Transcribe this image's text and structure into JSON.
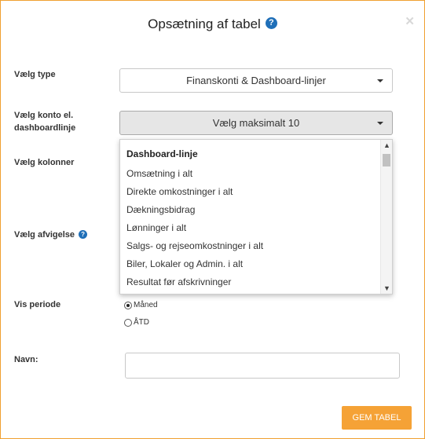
{
  "dialog": {
    "title": "Opsætning af tabel",
    "help_icon": "question-circle-icon",
    "close_icon": "close-x-icon",
    "close_glyph": "✕"
  },
  "fields": {
    "type_label": "Vælg type",
    "type_value": "Finanskonti & Dashboard-linjer",
    "account_label_line1": "Vælg konto el.",
    "account_label_line2": "dashboardlinje",
    "account_value": "Vælg maksimalt 10",
    "columns_label": "Vælg kolonner",
    "deviation_label": "Vælg afvigelse",
    "period_label": "Vis periode",
    "name_label": "Navn:",
    "name_value": ""
  },
  "dropdown": {
    "group_label": "Dashboard-linje",
    "items": [
      "Omsætning i alt",
      "Direkte omkostninger i alt",
      "Dækningsbidrag",
      "Lønninger i alt",
      "Salgs- og rejseomkostninger i alt",
      "Biler, Lokaler og Admin. i alt",
      "Resultat før afskrivninger"
    ]
  },
  "period_options": [
    {
      "label": "Måned",
      "checked": true
    },
    {
      "label": "ÅTD",
      "checked": false
    }
  ],
  "buttons": {
    "save_label": "GEM TABEL"
  },
  "colors": {
    "accent": "#f5a236",
    "help_blue": "#1f6fb8",
    "border_accent": "#f0a030"
  }
}
